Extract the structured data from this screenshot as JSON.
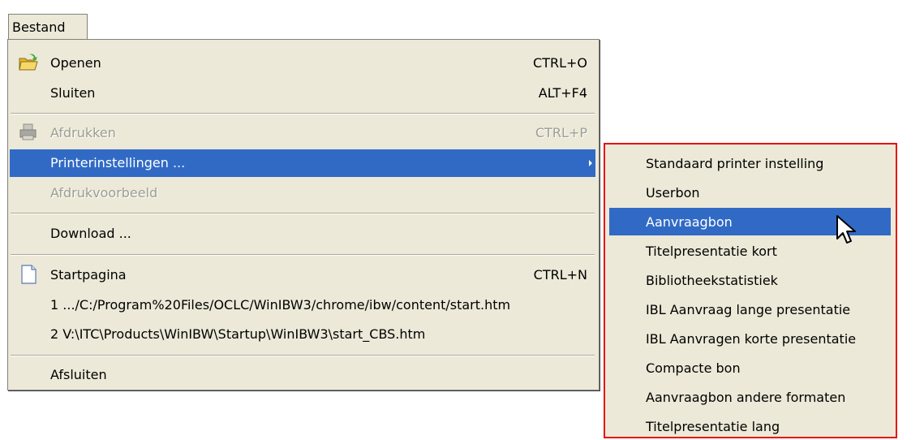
{
  "menubar": {
    "file_label": "Bestand"
  },
  "menu": {
    "items": [
      {
        "label": "Openen",
        "shortcut": "CTRL+O",
        "icon": "open-folder-icon"
      },
      {
        "label": "Sluiten",
        "shortcut": "ALT+F4"
      },
      {
        "label": "Afdrukken",
        "shortcut": "CTRL+P",
        "icon": "printer-icon",
        "disabled": true
      },
      {
        "label": "Printerinstellingen ...",
        "selected": true,
        "submenu": true
      },
      {
        "label": "Afdrukvoorbeeld",
        "disabled": true
      },
      {
        "label": "Download ..."
      },
      {
        "label": "Startpagina",
        "shortcut": "CTRL+N",
        "icon": "page-icon"
      },
      {
        "label": "1 .../C:/Program%20Files/OCLC/WinIBW3/chrome/ibw/content/start.htm"
      },
      {
        "label": "2 V:\\ITC\\Products\\WinIBW\\Startup\\WinIBW3\\start_CBS.htm"
      },
      {
        "label": "Afsluiten"
      }
    ]
  },
  "submenu": {
    "items": [
      {
        "label": "Standaard printer instelling"
      },
      {
        "label": "Userbon"
      },
      {
        "label": "Aanvraagbon",
        "selected": true
      },
      {
        "label": "Titelpresentatie kort"
      },
      {
        "label": "Bibliotheekstatistiek"
      },
      {
        "label": "IBL Aanvraag lange presentatie"
      },
      {
        "label": "IBL Aanvragen korte presentatie"
      },
      {
        "label": "Compacte bon"
      },
      {
        "label": "Aanvraagbon andere formaten"
      },
      {
        "label": "Titelpresentatie lang"
      }
    ]
  },
  "colors": {
    "menu_bg": "#ece9d8",
    "highlight": "#316ac5",
    "annotation_border": "#e81010"
  }
}
